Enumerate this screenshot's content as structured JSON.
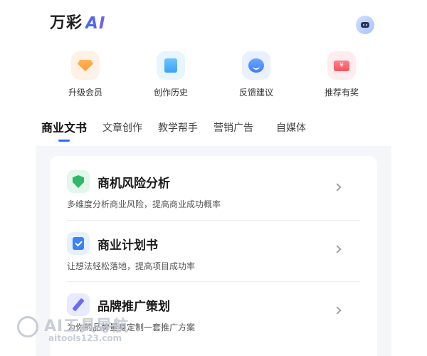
{
  "header": {
    "logo_text": "万彩",
    "logo_ai": "AI"
  },
  "quick_actions": [
    {
      "label": "升级会员",
      "icon": "diamond-icon"
    },
    {
      "label": "创作历史",
      "icon": "book-icon"
    },
    {
      "label": "反馈建议",
      "icon": "chat-bubble-icon"
    },
    {
      "label": "推荐有奖",
      "icon": "ticket-icon"
    }
  ],
  "quick_ticket_symbol": "¥",
  "tabs": [
    {
      "label": "商业文书",
      "active": true
    },
    {
      "label": "文章创作",
      "active": false
    },
    {
      "label": "教学帮手",
      "active": false
    },
    {
      "label": "营销广告",
      "active": false
    },
    {
      "label": "自媒体",
      "active": false
    }
  ],
  "tools": [
    {
      "title": "商机风险分析",
      "desc": "多维度分析商业风险，提高商业成功概率",
      "icon": "shield-icon",
      "color": "#2fb86a"
    },
    {
      "title": "商业计划书",
      "desc": "让想法轻松落地，提高项目成功率",
      "icon": "clipboard-check-icon",
      "color": "#3b82f6"
    },
    {
      "title": "品牌推广策划",
      "desc": "为你的品牌量身定制一套推广方案",
      "icon": "pen-icon",
      "color": "#6a6cf5"
    }
  ],
  "watermark": {
    "title": "AI工具导航",
    "url": "aitools123.com"
  },
  "colors": {
    "accent": "#2f6bff",
    "background": "#ffffff",
    "panel": "#f4f6fa"
  }
}
